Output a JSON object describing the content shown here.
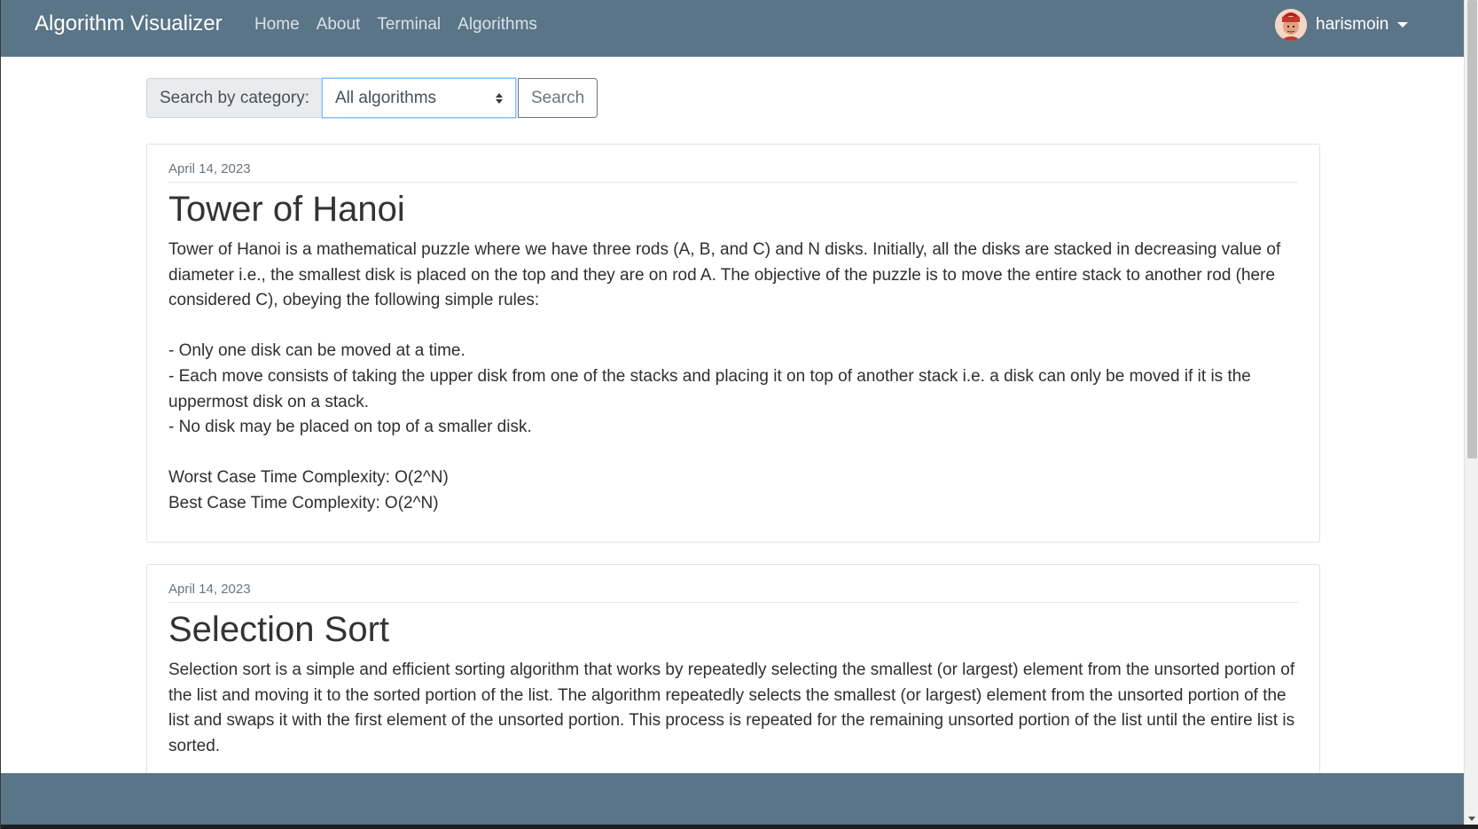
{
  "navbar": {
    "brand": "Algorithm Visualizer",
    "links": [
      "Home",
      "About",
      "Terminal",
      "Algorithms"
    ],
    "username": "harismoin"
  },
  "search": {
    "label": "Search by category:",
    "selected": "All algorithms",
    "button": "Search"
  },
  "posts": [
    {
      "date": "April 14, 2023",
      "title": "Tower of Hanoi",
      "body": "Tower of Hanoi is a mathematical puzzle where we have three rods (A, B, and C) and N disks. Initially, all the disks are stacked in decreasing value of diameter i.e., the smallest disk is placed on the top and they are on rod A. The objective of the puzzle is to move the entire stack to another rod (here considered C), obeying the following simple rules:\n\n- Only one disk can be moved at a time.\n- Each move consists of taking the upper disk from one of the stacks and placing it on top of another stack i.e. a disk can only be moved if it is the uppermost disk on a stack.\n- No disk may be placed on top of a smaller disk.\n\nWorst Case Time Complexity: O(2^N)\nBest Case Time Complexity: O(2^N)"
    },
    {
      "date": "April 14, 2023",
      "title": "Selection Sort",
      "body": "Selection sort is a simple and efficient sorting algorithm that works by repeatedly selecting the smallest (or largest) element from the unsorted portion of the list and moving it to the sorted portion of the list. The algorithm repeatedly selects the smallest (or largest) element from the unsorted portion of the list and swaps it with the first element of the unsorted portion. This process is repeated for the remaining unsorted portion of the list until the entire list is sorted."
    }
  ],
  "icons": {
    "avatar": "user-avatar-icon",
    "caret": "caret-down-icon",
    "select": "select-arrows-icon"
  },
  "colors": {
    "navbar": "#5a7587",
    "footer": "#5a7587",
    "select_focus": "#80bdff"
  }
}
